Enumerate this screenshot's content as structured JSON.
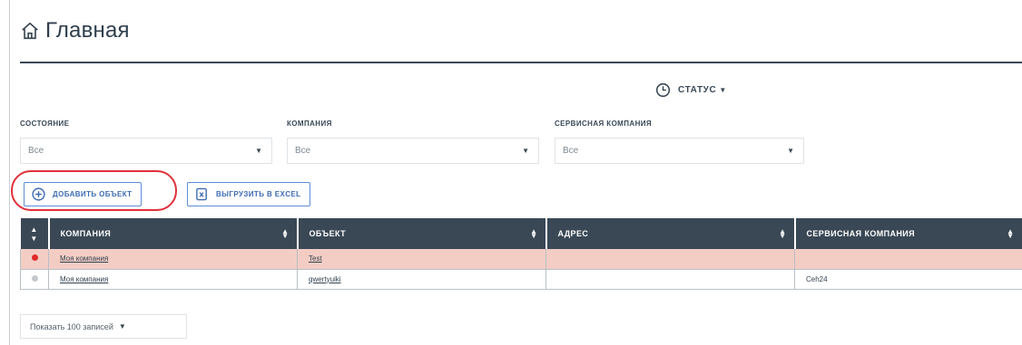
{
  "header": {
    "title": "Главная"
  },
  "status": {
    "label": "СТАТУС"
  },
  "filters": [
    {
      "label": "СОСТОЯНИЕ",
      "value": "Все"
    },
    {
      "label": "КОМПАНИЯ",
      "value": "Все"
    },
    {
      "label": "СЕРВИСНАЯ КОМПАНИЯ",
      "value": "Все"
    }
  ],
  "actions": {
    "add_object": "ДОБАВИТЬ ОБЪЕКТ",
    "export_excel": "ВЫГРУЗИТЬ В EXCEL"
  },
  "table": {
    "columns": [
      "КОМПАНИЯ",
      "ОБЪЕКТ",
      "АДРЕС",
      "СЕРВИСНАЯ КОМПАНИЯ"
    ],
    "rows": [
      {
        "status_color": "#e02a2a",
        "company": "Моя компания",
        "object": "Test",
        "address": "",
        "service_company": ""
      },
      {
        "status_color": "#c4c9ce",
        "company": "Моя компания",
        "object": "qwertyuiki",
        "address": "",
        "service_company": "Ceh24"
      }
    ]
  },
  "pagination": {
    "page_size_label": "Показать 100 записей"
  },
  "colors": {
    "header_bg": "#3a4856",
    "alert_row_bg": "#f3cdc4",
    "highlight_ring": "#e0303a",
    "button_border": "#5a8dd8"
  }
}
